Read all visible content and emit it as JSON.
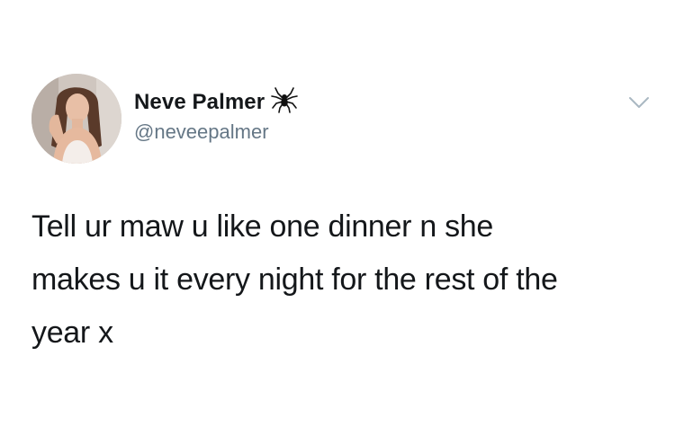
{
  "tweet": {
    "author": {
      "display_name": "Neve Palmer",
      "handle": "@neveepalmer",
      "avatar": "profile-photo",
      "name_emoji": "spider-icon"
    },
    "menu_icon": "chevron-down-icon",
    "text_lines": [
      "Tell ur maw u like one dinner n she",
      "makes u it every night for the rest of the",
      "year x"
    ]
  },
  "colors": {
    "background": "#ffffff",
    "primary_text": "#14171a",
    "secondary_text": "#657786",
    "chevron": "#aab8c2"
  }
}
